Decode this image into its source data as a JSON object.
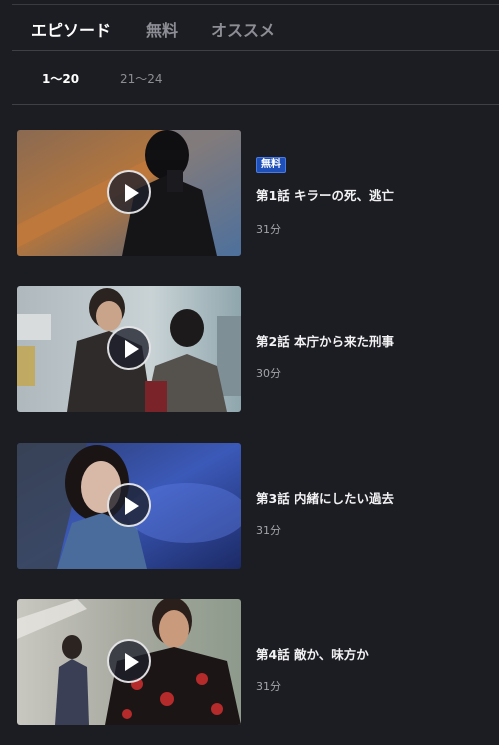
{
  "tabs": [
    {
      "label": "エピソード",
      "active": true
    },
    {
      "label": "無料",
      "active": false
    },
    {
      "label": "オススメ",
      "active": false
    }
  ],
  "ranges": [
    {
      "label": "1〜20",
      "active": true
    },
    {
      "label": "21〜24",
      "active": false
    }
  ],
  "episodes": [
    {
      "title": "第1話 キラーの死、逃亡",
      "duration": "31分",
      "badge": "無料"
    },
    {
      "title": "第2話 本庁から来た刑事",
      "duration": "30分"
    },
    {
      "title": "第3話 内緒にしたい過去",
      "duration": "31分"
    },
    {
      "title": "第4話 敵か、味方か",
      "duration": "31分"
    }
  ],
  "colors": {
    "background": "#1c1d22",
    "badge": "#1f4fb8",
    "active_text": "#ffffff",
    "inactive_text": "#8d8e95"
  }
}
